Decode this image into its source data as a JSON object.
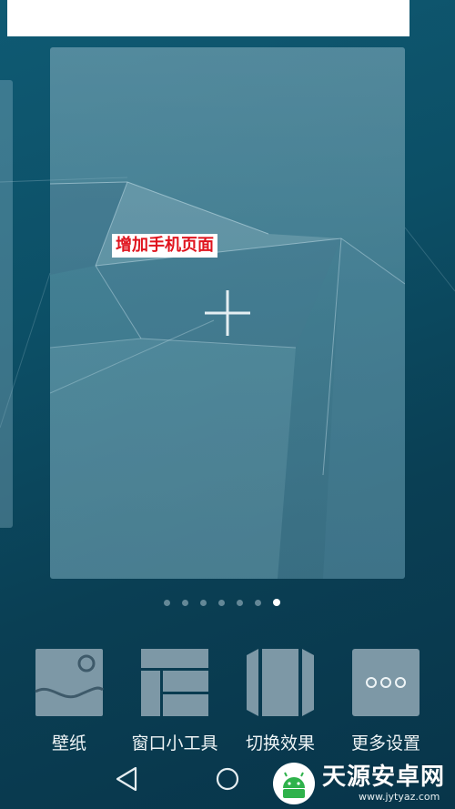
{
  "annotation": {
    "text": "增加手机页面"
  },
  "page_indicator": {
    "total": 7,
    "active": 7
  },
  "toolbar": {
    "items": [
      {
        "label": "壁纸",
        "icon": "wallpaper-icon"
      },
      {
        "label": "窗口小工具",
        "icon": "widgets-icon"
      },
      {
        "label": "切换效果",
        "icon": "transition-effects-icon"
      },
      {
        "label": "更多设置",
        "icon": "more-settings-icon"
      }
    ]
  },
  "navigation": {
    "back": "back-icon",
    "home": "home-icon"
  },
  "watermark": {
    "title": "天源安卓网",
    "url": "www.jytyaz.com"
  },
  "colors": {
    "annotation_text": "#e0141e",
    "background": "#0c4f66"
  }
}
